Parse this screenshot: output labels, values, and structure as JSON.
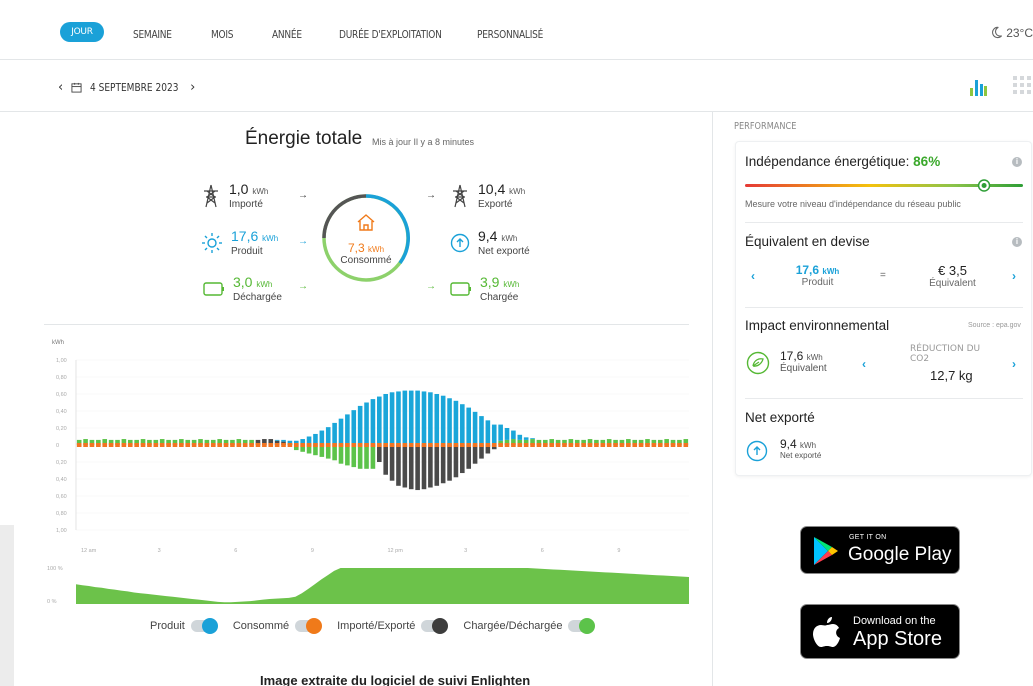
{
  "tabs": [
    {
      "label": "JOUR",
      "active": true
    },
    {
      "label": "SEMAINE"
    },
    {
      "label": "MOIS"
    },
    {
      "label": "ANNÉE"
    },
    {
      "label": "DURÉE D'EXPLOITATION"
    },
    {
      "label": "PERSONNALISÉ"
    }
  ],
  "weather": {
    "icon": "moon-icon",
    "temp": "23°C"
  },
  "date": {
    "label": "4 SEPTEMBRE 2023"
  },
  "summary": {
    "title": "Énergie totale",
    "updated": "Mis à jour Il y a 8 minutes",
    "imported": {
      "value": "1,0",
      "unit": "kWh",
      "label": "Importé"
    },
    "exported": {
      "value": "10,4",
      "unit": "kWh",
      "label": "Exporté"
    },
    "produced": {
      "value": "17,6",
      "unit": "kWh",
      "label": "Produit"
    },
    "net_exported": {
      "value": "9,4",
      "unit": "kWh",
      "label": "Net exporté"
    },
    "discharged": {
      "value": "3,0",
      "unit": "kWh",
      "label": "Déchargée"
    },
    "charged": {
      "value": "3,9",
      "unit": "kWh",
      "label": "Chargée"
    },
    "consumed": {
      "value": "7,3",
      "unit": "kWh",
      "label": "Consommé"
    }
  },
  "chart_data": {
    "type": "bar",
    "ylabel": "kWh",
    "ylim": [
      -1.0,
      1.0
    ],
    "yticks": [
      "1,00",
      "0,80",
      "0,60",
      "0,40",
      "0,20",
      "0",
      "0,20",
      "0,40",
      "0,60",
      "0,80",
      "1,00"
    ],
    "xticks": [
      "12 am",
      "3",
      "6",
      "9",
      "12 pm",
      "3",
      "6",
      "9"
    ],
    "series_names": [
      "Produit",
      "Consommé",
      "Importé/Exporté",
      "Chargée/Déchargée"
    ],
    "colors": {
      "produced": "#1aa6d9",
      "consumed": "#f27421",
      "grid": "#4a4a4a",
      "battery": "#5cc34a"
    },
    "intervals": 96,
    "produced": [
      0,
      0,
      0,
      0,
      0,
      0,
      0,
      0,
      0,
      0,
      0,
      0,
      0,
      0,
      0,
      0,
      0,
      0,
      0,
      0,
      0,
      0,
      0,
      0,
      0,
      0,
      0,
      0,
      0,
      0,
      0,
      0.01,
      0.02,
      0.03,
      0.05,
      0.07,
      0.1,
      0.13,
      0.17,
      0.21,
      0.26,
      0.31,
      0.36,
      0.41,
      0.46,
      0.5,
      0.54,
      0.57,
      0.6,
      0.62,
      0.63,
      0.64,
      0.64,
      0.64,
      0.63,
      0.62,
      0.6,
      0.58,
      0.55,
      0.52,
      0.48,
      0.44,
      0.39,
      0.34,
      0.29,
      0.24,
      0.19,
      0.14,
      0.1,
      0.06,
      0.03,
      0.01,
      0,
      0,
      0,
      0,
      0,
      0,
      0,
      0,
      0,
      0,
      0,
      0,
      0,
      0,
      0,
      0,
      0,
      0,
      0,
      0,
      0,
      0,
      0,
      0
    ],
    "consumed": [
      0.06,
      0.06,
      0.07,
      0.06,
      0.06,
      0.07,
      0.06,
      0.06,
      0.07,
      0.06,
      0.06,
      0.07,
      0.06,
      0.06,
      0.07,
      0.06,
      0.06,
      0.07,
      0.06,
      0.06,
      0.07,
      0.06,
      0.06,
      0.07,
      0.06,
      0.06,
      0.07,
      0.06,
      0.06,
      0.07,
      0.06,
      0.06,
      0.07,
      0.06,
      0.06,
      0.07,
      0.06,
      0.06,
      0.07,
      0.06,
      0.06,
      0.07,
      0.06,
      0.06,
      0.07,
      0.06,
      0.06,
      0.07,
      0.06,
      0.06,
      0.07,
      0.06,
      0.06,
      0.07,
      0.06,
      0.06,
      0.07,
      0.06,
      0.06,
      0.07,
      0.06,
      0.06,
      0.07,
      0.06,
      0.06,
      0.07,
      0.06,
      0.06,
      0.07,
      0.06,
      0.06,
      0.07,
      0.06,
      0.06,
      0.07,
      0.06,
      0.06,
      0.07,
      0.06,
      0.06,
      0.07,
      0.06,
      0.06,
      0.07,
      0.06,
      0.06,
      0.07,
      0.06,
      0.06,
      0.07,
      0.06,
      0.06,
      0.07,
      0.06,
      0.06,
      0.07
    ],
    "grid": [
      0,
      0,
      0,
      0,
      0,
      0,
      0,
      0,
      0,
      0,
      0,
      0,
      0,
      0,
      0,
      0,
      0,
      0,
      0,
      0,
      0,
      0,
      0,
      0,
      0,
      0,
      0,
      0,
      0.06,
      0.07,
      0.07,
      0.05,
      0.04,
      0.02,
      0,
      0,
      0,
      0,
      0,
      0,
      0,
      0,
      0,
      0,
      0,
      0,
      0,
      -0.2,
      -0.35,
      -0.42,
      -0.48,
      -0.5,
      -0.52,
      -0.53,
      -0.52,
      -0.5,
      -0.48,
      -0.45,
      -0.42,
      -0.38,
      -0.33,
      -0.28,
      -0.22,
      -0.16,
      -0.1,
      -0.05,
      0,
      0,
      0,
      0,
      0,
      0,
      0,
      0,
      0,
      0,
      0,
      0,
      0,
      0,
      0,
      0,
      0,
      0,
      0,
      0,
      0,
      0,
      0,
      0,
      0,
      0,
      0,
      0,
      0,
      0
    ],
    "battery": [
      0.06,
      0.07,
      0.06,
      0.06,
      0.07,
      0.06,
      0.06,
      0.07,
      0.06,
      0.06,
      0.07,
      0.06,
      0.06,
      0.07,
      0.06,
      0.06,
      0.07,
      0.06,
      0.06,
      0.07,
      0.06,
      0.06,
      0.07,
      0.06,
      0.06,
      0.07,
      0.06,
      0.06,
      0,
      0,
      0,
      0,
      0,
      0,
      -0.06,
      -0.08,
      -0.1,
      -0.12,
      -0.14,
      -0.16,
      -0.18,
      -0.22,
      -0.24,
      -0.26,
      -0.28,
      -0.28,
      -0.28,
      0,
      0,
      0,
      0,
      0,
      0,
      0,
      0,
      0,
      0,
      0,
      0,
      0,
      0,
      0,
      0,
      0,
      0,
      0,
      0.05,
      0.06,
      0.07,
      0.06,
      0.06,
      0.07,
      0.06,
      0.06,
      0.07,
      0.06,
      0.06,
      0.07,
      0.06,
      0.06,
      0.07,
      0.06,
      0.06,
      0.07,
      0.06,
      0.06,
      0.07,
      0.06,
      0.06,
      0.07,
      0.06,
      0.06,
      0.07,
      0.06,
      0.06,
      0.07
    ],
    "soc_ticks": [
      "100 %",
      "0 %"
    ],
    "soc": [
      0.55,
      0.52,
      0.5,
      0.47,
      0.45,
      0.42,
      0.4,
      0.37,
      0.35,
      0.32,
      0.3,
      0.28,
      0.26,
      0.24,
      0.22,
      0.2,
      0.18,
      0.16,
      0.14,
      0.12,
      0.1,
      0.08,
      0.06,
      0.05,
      0.05,
      0.06,
      0.07,
      0.08,
      0.1,
      0.12,
      0.14,
      0.15,
      0.16,
      0.17,
      0.2,
      0.3,
      0.42,
      0.55,
      0.68,
      0.8,
      0.92,
      1,
      1,
      1,
      1,
      1,
      1,
      1,
      1,
      1,
      1,
      1,
      1,
      1,
      1,
      1,
      1,
      1,
      1,
      1,
      1,
      1,
      1,
      1,
      1,
      1,
      1,
      1,
      1,
      1,
      1,
      0.99,
      0.98,
      0.97,
      0.96,
      0.95,
      0.94,
      0.93,
      0.92,
      0.91,
      0.9,
      0.89,
      0.88,
      0.87,
      0.86,
      0.85,
      0.84,
      0.83,
      0.82,
      0.81,
      0.8,
      0.79,
      0.78,
      0.77,
      0.76,
      0.75
    ]
  },
  "legend": [
    {
      "label": "Produit",
      "color": "#1aa1d8"
    },
    {
      "label": "Consommé",
      "color": "#f07a1a"
    },
    {
      "label": "Importé/Exporté",
      "color": "#3d3d3d"
    },
    {
      "label": "Chargée/Déchargée",
      "color": "#5cc34a"
    }
  ],
  "caption": "Image extraite du logiciel de suivi Enlighten",
  "performance": {
    "heading": "PERFORMANCE",
    "independence": {
      "title": "Indépendance énergétique:",
      "value": "86%",
      "level": 0.86,
      "desc": "Mesure votre niveau d'indépendance du réseau public"
    },
    "currency": {
      "title": "Équivalent en devise",
      "left_value": "17,6",
      "left_unit": "kWh",
      "left_label": "Produit",
      "equals": "=",
      "right_value": "€ 3,5",
      "right_label": "Équivalent"
    },
    "environment": {
      "title": "Impact environnemental",
      "source": "Source : epa.gov",
      "left_value": "17,6",
      "left_unit": "kWh",
      "left_label": "Équivalent",
      "right_label": "RÉDUCTION DU CO2",
      "right_value": "12,7 kg"
    },
    "net": {
      "title": "Net exporté",
      "value": "9,4",
      "unit": "kWh",
      "label": "Net exporté"
    }
  },
  "badges": {
    "google": {
      "top": "GET IT ON",
      "main": "Google Play"
    },
    "apple": {
      "top": "Download on the",
      "main": "App Store"
    }
  }
}
